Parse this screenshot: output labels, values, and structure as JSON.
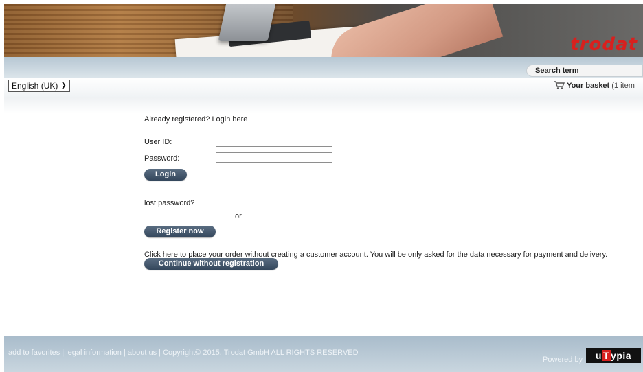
{
  "banner": {
    "logo_text": "trodat"
  },
  "header": {
    "search_label": "Search term",
    "language_selected": "English (UK)",
    "basket_label": "Your basket",
    "basket_count": "(1 item"
  },
  "login": {
    "heading": "Already registered? Login here",
    "userid_label": "User ID:",
    "userid_value": "",
    "password_label": "Password:",
    "password_value": "",
    "login_button": "Login",
    "lost_password": "lost password?",
    "or_text": "or",
    "register_button": "Register now",
    "guest_text": "Click here to place your order without creating a customer account. You will be only asked for the data necessary for payment and delivery.",
    "guest_button": "Continue without registration"
  },
  "footer": {
    "links": [
      "add to favorites",
      "legal information",
      "about us"
    ],
    "separator": " | ",
    "copyright": "Copyright© 2015, Trodat GmbH ALL RIGHTS RESERVED",
    "powered_by": "Powered by",
    "brand_left": "u",
    "brand_mid": "T",
    "brand_right": "ypia"
  },
  "colors": {
    "button": "#3e5166",
    "logo_red": "#d8201e",
    "header_blue": "#b6c7d3"
  }
}
